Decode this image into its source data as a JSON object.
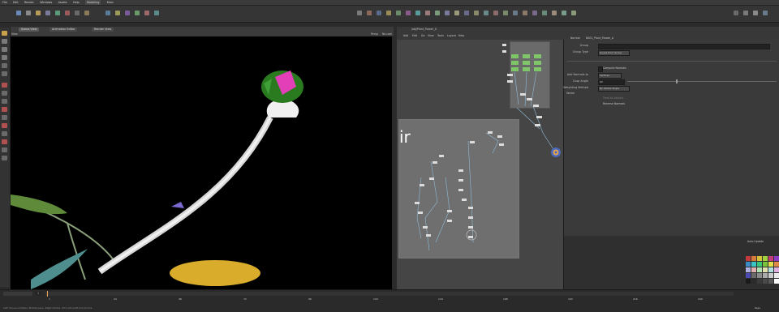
{
  "app": {
    "menu": [
      "File",
      "Edit",
      "Render",
      "Windows",
      "Assets",
      "Help"
    ],
    "desktop": "Modeling",
    "take": "Main"
  },
  "viewport": {
    "tabs": [
      "Scene View",
      "Animation Editor",
      "Render View"
    ],
    "view_label": "View",
    "persp_label": "Persp",
    "cam_label": "No cam"
  },
  "network": {
    "path": "/obj/Plant_Flower_A",
    "menu": [
      "Add",
      "Edit",
      "Go",
      "View",
      "Tools",
      "Layout",
      "Help"
    ],
    "display_text": "ir"
  },
  "params": {
    "node_type": "Normal",
    "node_name": "N001_Plant_Flower_A",
    "rows": [
      {
        "label": "Group",
        "value": ""
      },
      {
        "label": "Group Type",
        "value": "Guess from Group"
      },
      {
        "label": "",
        "value": ""
      },
      {
        "label": "",
        "value": "Compute Normals"
      },
      {
        "label": "Add Normals to",
        "value": "Vertices"
      },
      {
        "label": "Cusp Angle",
        "value": "60"
      },
      {
        "label": "Weighting Method",
        "value": "By Vertex Angle"
      }
    ],
    "section": "Vector",
    "checks": [
      "Treat as Vectors",
      "Reverse Normals"
    ]
  },
  "timeline": {
    "frames": [
      "1",
      "24",
      "48",
      "72",
      "96",
      "120",
      "144",
      "168",
      "192",
      "216",
      "240"
    ],
    "current": "1",
    "status": "Left mouse tumbles. Middle pans. Right dollies. Ctrl+Alt+Left box-zooms."
  },
  "bottom_right": {
    "auto_update": "Auto Update",
    "keys": "Keys"
  },
  "colors": {
    "accent": "#e8a54a",
    "viewport_bg": "#000000",
    "network_bg": "#454545",
    "node_green": "#7fc66a",
    "flower_pink": "#e23fb9",
    "leaf_yellow": "#d9ac2c"
  }
}
